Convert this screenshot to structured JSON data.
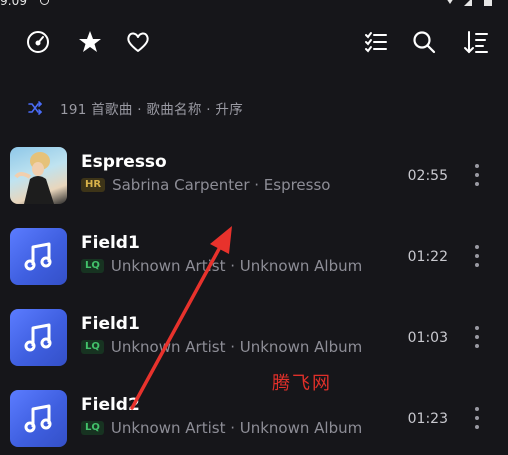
{
  "status": {
    "time": "9:09"
  },
  "toolbar": {
    "left_icons": [
      "gauge-icon",
      "star-sparkle-icon",
      "heart-icon"
    ],
    "right_icons": [
      "checklist-icon",
      "search-icon",
      "sort-icon"
    ]
  },
  "summary": {
    "text": "191 首歌曲 · 歌曲名称 · 升序",
    "accent": "#4a6cf7"
  },
  "songs": [
    {
      "title": "Espresso",
      "quality": "HR",
      "subtitle": "Sabrina Carpenter · Espresso",
      "duration": "02:55"
    },
    {
      "title": "Field1",
      "quality": "LQ",
      "subtitle": "Unknown Artist · Unknown Album",
      "duration": "01:22"
    },
    {
      "title": "Field1",
      "quality": "LQ",
      "subtitle": "Unknown Artist · Unknown Album",
      "duration": "01:03"
    },
    {
      "title": "Field2",
      "quality": "LQ",
      "subtitle": "Unknown Artist · Unknown Album",
      "duration": "01:23"
    }
  ],
  "watermark": "腾飞网",
  "annotation_color": "#e8322c"
}
